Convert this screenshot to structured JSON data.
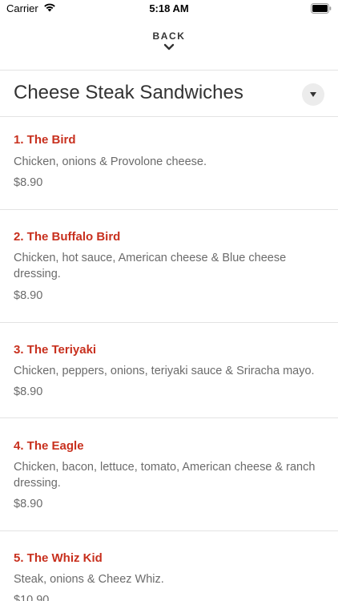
{
  "status_bar": {
    "carrier": "Carrier",
    "time": "5:18 AM"
  },
  "header": {
    "back_label": "BACK"
  },
  "section": {
    "title": "Cheese Steak Sandwiches"
  },
  "items": [
    {
      "name": "1. The Bird",
      "description": "Chicken, onions & Provolone cheese.",
      "price": "$8.90"
    },
    {
      "name": "2. The Buffalo Bird",
      "description": "Chicken, hot sauce, American cheese & Blue cheese dressing.",
      "price": "$8.90"
    },
    {
      "name": "3. The Teriyaki",
      "description": "Chicken, peppers, onions, teriyaki sauce & Sriracha mayo.",
      "price": "$8.90"
    },
    {
      "name": "4. The Eagle",
      "description": "Chicken, bacon, lettuce, tomato, American cheese & ranch dressing.",
      "price": "$8.90"
    },
    {
      "name": "5. The Whiz Kid",
      "description": "Steak, onions & Cheez Whiz.",
      "price": "$10.90"
    }
  ],
  "colors": {
    "item_name": "#c8301e",
    "text_gray": "#6b6b6b",
    "divider": "#e3e3e3"
  },
  "icons": [
    "wifi-icon",
    "battery-icon",
    "chevron-down-icon",
    "dropdown-triangle-icon"
  ]
}
